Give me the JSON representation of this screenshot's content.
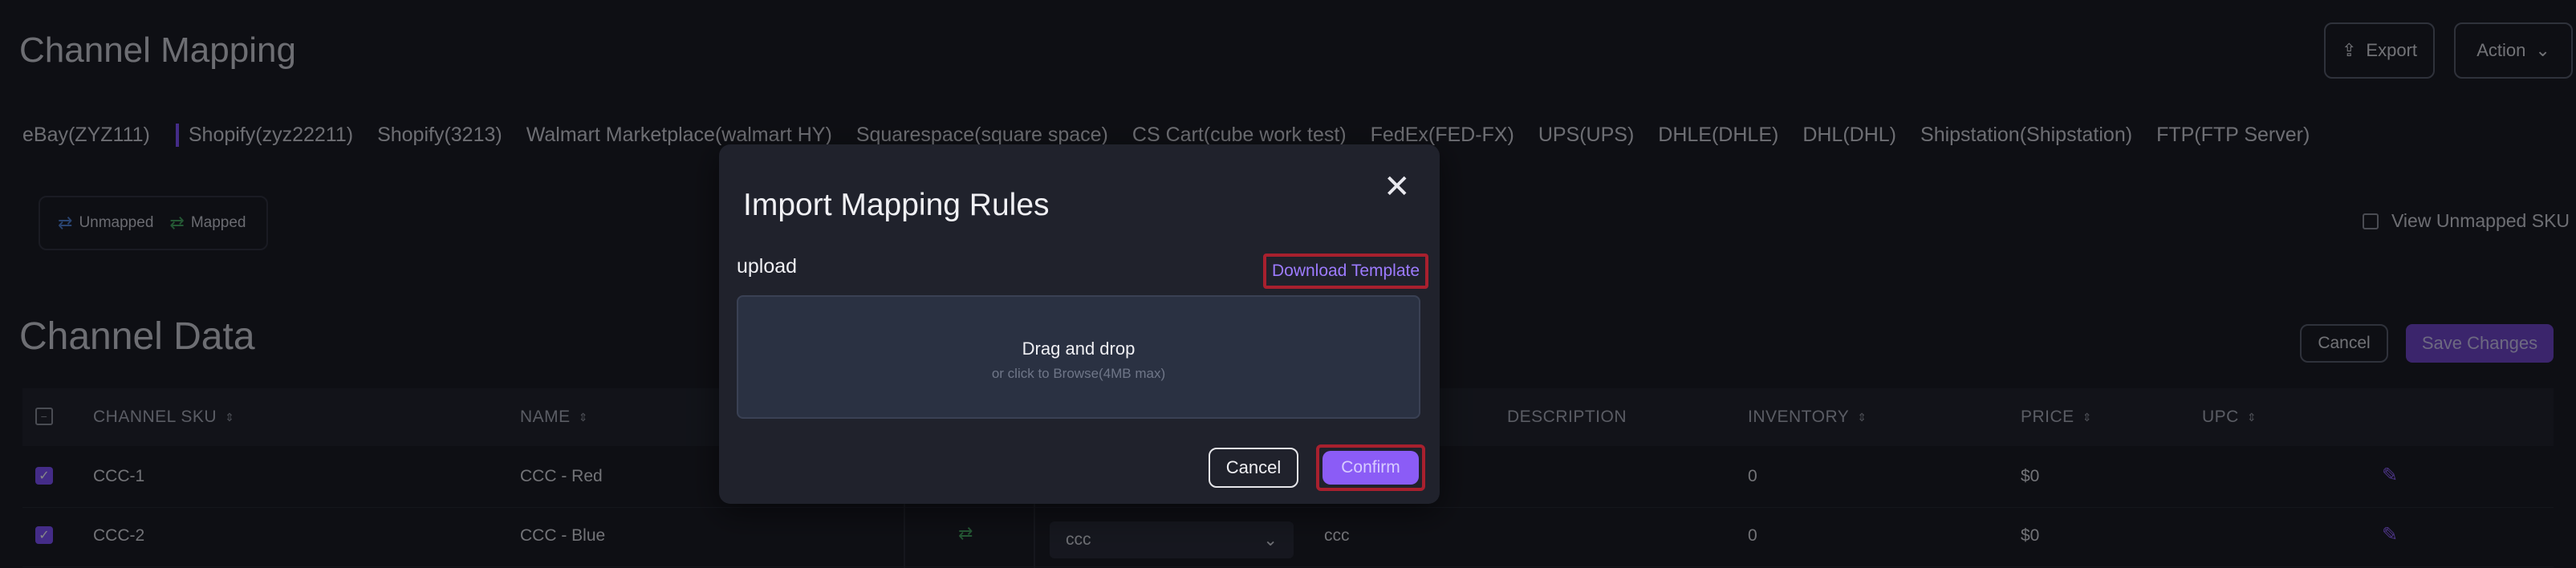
{
  "header": {
    "title": "Channel Mapping",
    "export_label": "Export",
    "action_label": "Action"
  },
  "tabs": [
    "eBay(ZYZ111)",
    "Shopify(zyz22211)",
    "Shopify(3213)",
    "Walmart Marketplace(walmart HY)",
    "Squarespace(square space)",
    "CS Cart(cube work test)",
    "FedEx(FED-FX)",
    "UPS(UPS)",
    "DHLE(DHLE)",
    "DHL(DHL)",
    "Shipstation(Shipstation)",
    "FTP(FTP Server)"
  ],
  "legend": {
    "unmapped_label": "Unmapped",
    "mapped_label": "Mapped"
  },
  "view_unmapped_label": "View Unmapped SKU",
  "channel_data": {
    "title": "Channel Data",
    "cancel_label": "Cancel",
    "save_label": "Save Changes",
    "columns": {
      "channel_sku": "CHANNEL SKU",
      "name": "NAME",
      "description": "DESCRIPTION",
      "inventory": "INVENTORY",
      "price": "PRICE",
      "upc": "UPC"
    },
    "rows": [
      {
        "sku": "CCC-1",
        "name": "CCC - Red",
        "inventory": "0",
        "price": "$0",
        "mapped_select": "",
        "description": ""
      },
      {
        "sku": "CCC-2",
        "name": "CCC - Blue",
        "inventory": "0",
        "price": "$0",
        "mapped_select": "ccc",
        "description": "ccc"
      }
    ]
  },
  "modal": {
    "title": "Import Mapping Rules",
    "upload_label": "upload",
    "download_template_label": "Download Template",
    "dropzone_main": "Drag and drop",
    "dropzone_sub": "or click to Browse(4MB max)",
    "cancel_label": "Cancel",
    "confirm_label": "Confirm"
  },
  "colors": {
    "accent": "#8b5cf6",
    "highlight_border": "#a8202e",
    "background": "#121319"
  }
}
